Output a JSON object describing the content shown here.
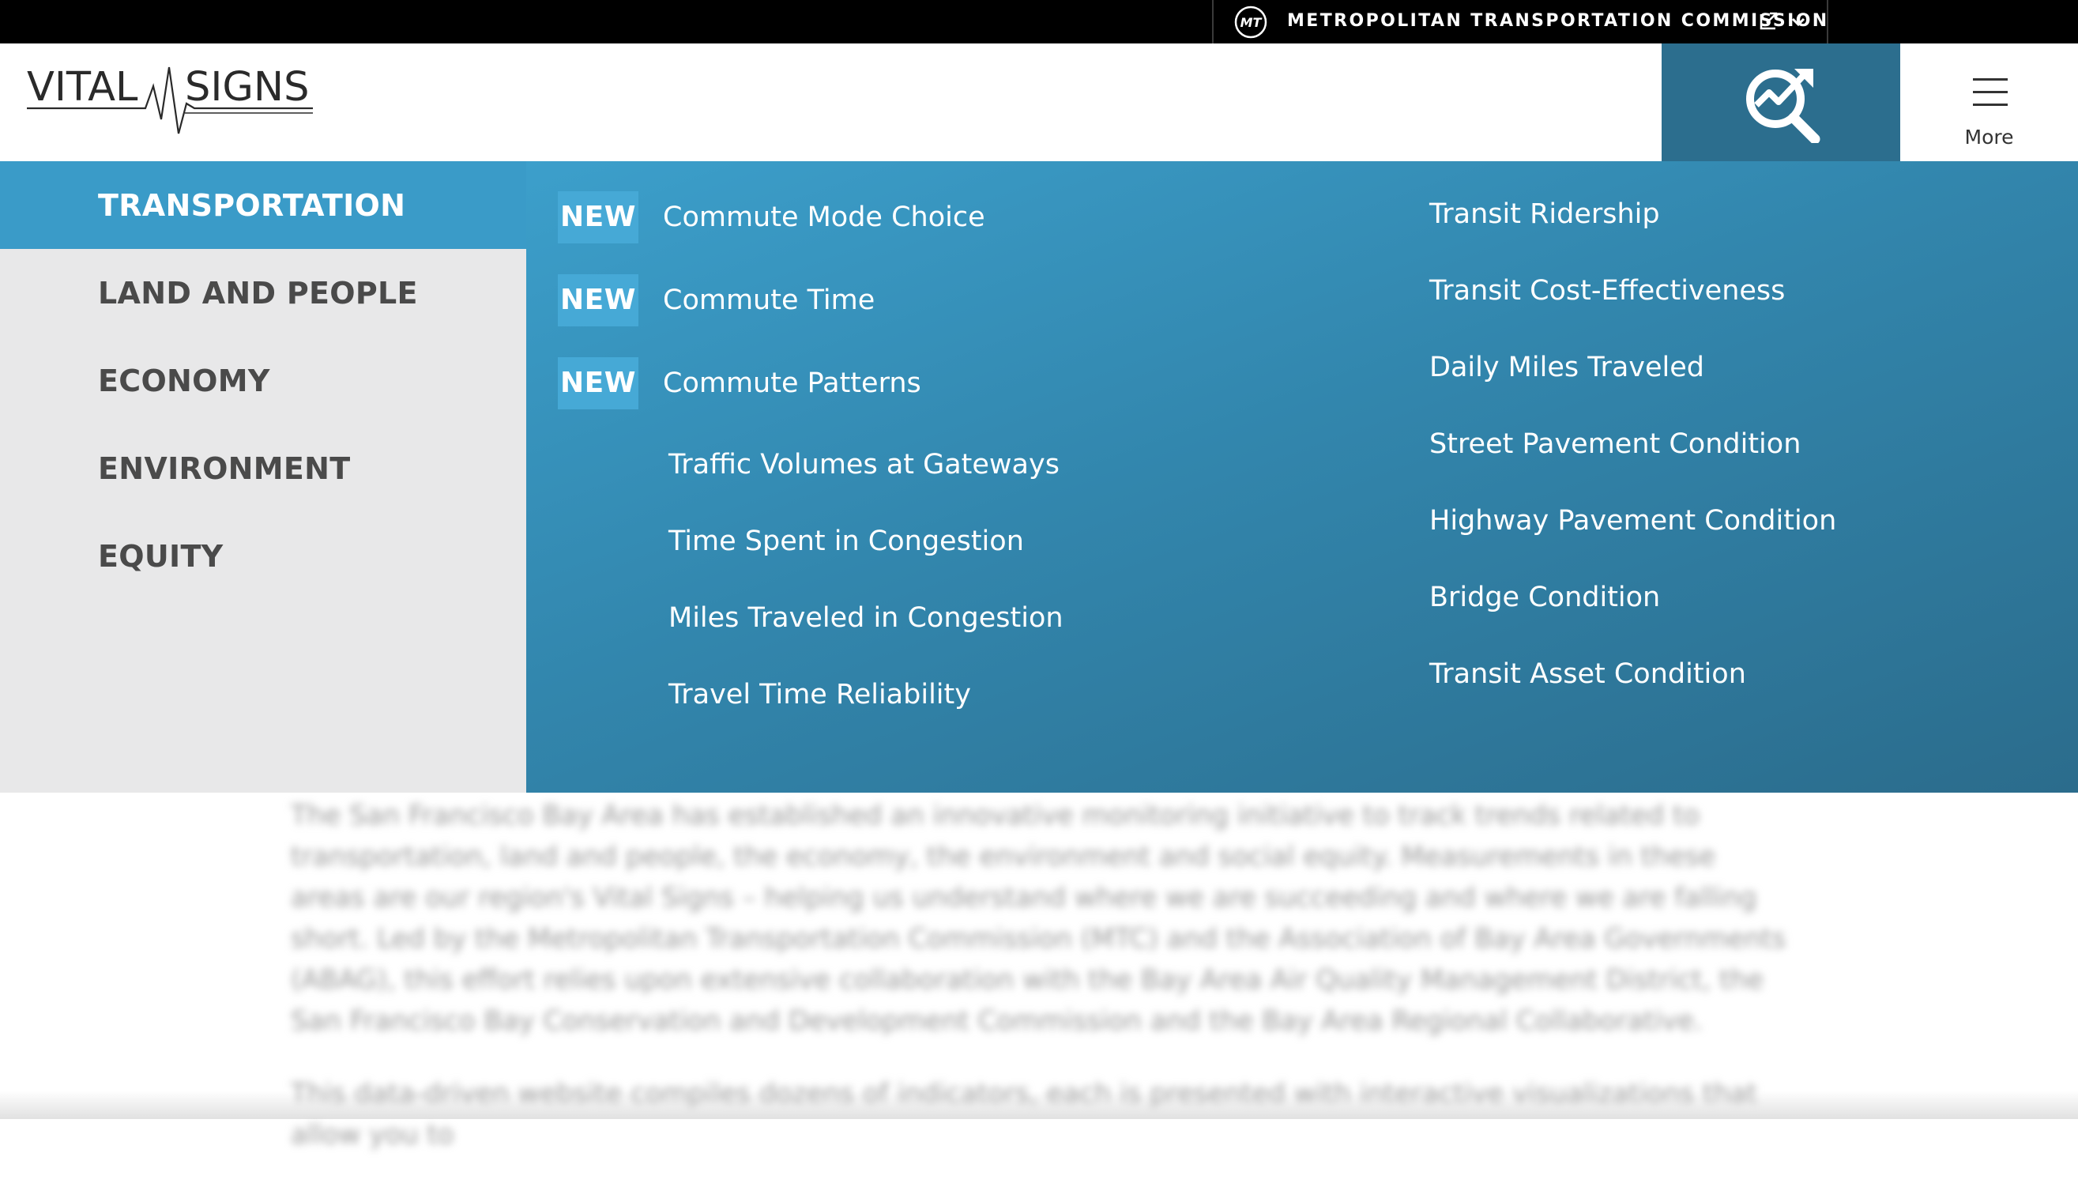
{
  "topbar": {
    "org_name": "METROPOLITAN TRANSPORTATION COMMISSION",
    "logo_text": "MT",
    "external_icon": "external-link-icon",
    "dropdown_icon": "chevron-down-icon"
  },
  "header": {
    "logo_left": "VITAL",
    "logo_right": "SIGNS",
    "search_icon": "search-trend-icon",
    "more_icon": "hamburger-icon",
    "more_label": "More"
  },
  "colors": {
    "active_category": "#3a9bc8",
    "menu_gradient_start": "#3c9fcb",
    "menu_gradient_end": "#2b6c8c",
    "search_button": "#2c6e8e",
    "new_badge": "#46a9d6",
    "category_panel": "#e8e8e9"
  },
  "menu": {
    "categories": [
      {
        "label": "TRANSPORTATION",
        "active": true
      },
      {
        "label": "LAND AND PEOPLE",
        "active": false
      },
      {
        "label": "ECONOMY",
        "active": false
      },
      {
        "label": "ENVIRONMENT",
        "active": false
      },
      {
        "label": "EQUITY",
        "active": false
      }
    ],
    "badge_label": "NEW",
    "column1": [
      {
        "label": "Commute Mode Choice",
        "new": true
      },
      {
        "label": "Commute Time",
        "new": true
      },
      {
        "label": "Commute Patterns",
        "new": true
      },
      {
        "label": "Traffic Volumes at Gateways",
        "new": false
      },
      {
        "label": "Time Spent in Congestion",
        "new": false
      },
      {
        "label": "Miles Traveled in Congestion",
        "new": false
      },
      {
        "label": "Travel Time Reliability",
        "new": false
      }
    ],
    "column2": [
      {
        "label": "Transit Ridership"
      },
      {
        "label": "Transit Cost-Effectiveness"
      },
      {
        "label": "Daily Miles Traveled"
      },
      {
        "label": "Street Pavement Condition"
      },
      {
        "label": "Highway Pavement Condition"
      },
      {
        "label": "Bridge Condition"
      },
      {
        "label": "Transit Asset Condition"
      }
    ]
  },
  "content": {
    "paragraph1": "The San Francisco Bay Area has established an innovative monitoring initiative to track trends related to transportation, land and people, the economy, the environment and social equity. Measurements in these areas are our region's Vital Signs – helping us understand where we are succeeding and where we are falling short. Led by the Metropolitan Transportation Commission (MTC) and the Association of Bay Area Governments (ABAG), this effort relies upon extensive collaboration with the Bay Area Air Quality Management District, the San Francisco Bay Conservation and Development Commission and the Bay Area Regional Collaborative.",
    "paragraph2": "This data-driven website compiles dozens of indicators, each is presented with interactive visualizations that allow you to"
  }
}
